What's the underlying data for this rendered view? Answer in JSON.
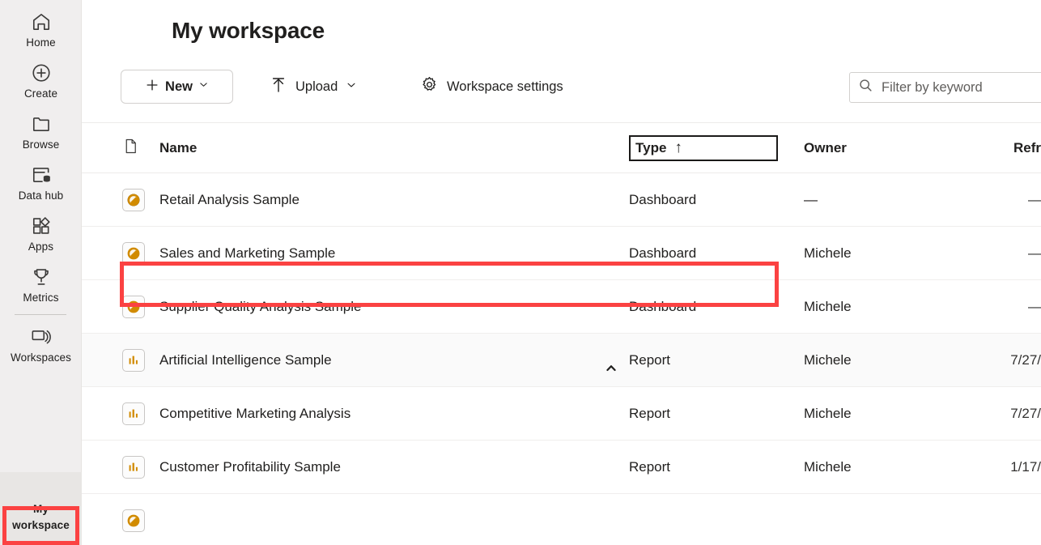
{
  "sidebar": {
    "items": [
      {
        "label": "Home",
        "icon": "home-icon"
      },
      {
        "label": "Create",
        "icon": "plus-circle-icon"
      },
      {
        "label": "Browse",
        "icon": "folder-icon"
      },
      {
        "label": "Data hub",
        "icon": "data-hub-icon"
      },
      {
        "label": "Apps",
        "icon": "apps-icon"
      },
      {
        "label": "Metrics",
        "icon": "trophy-icon"
      },
      {
        "label": "Workspaces",
        "icon": "workspaces-icon"
      }
    ],
    "selected": {
      "label_line1": "My",
      "label_line2": "workspace"
    },
    "accent_color": "#0f6e64"
  },
  "header": {
    "title": "My workspace"
  },
  "toolbar": {
    "new_label": "New",
    "upload_label": "Upload",
    "settings_label": "Workspace settings"
  },
  "search": {
    "placeholder": "Filter by keyword",
    "value": ""
  },
  "table": {
    "columns": {
      "icon": "",
      "name": "Name",
      "type": "Type",
      "owner": "Owner",
      "refresh": "Refr"
    },
    "sort": {
      "column": "Type",
      "direction": "ascending",
      "glyph": "↑"
    },
    "empty_value": "—",
    "rows": [
      {
        "icon": "dashboard-icon",
        "name": "Retail Analysis Sample",
        "type": "Dashboard",
        "owner": "—",
        "refresh": "—"
      },
      {
        "icon": "dashboard-icon",
        "name": "Sales and Marketing Sample",
        "type": "Dashboard",
        "owner": "Michele",
        "refresh": "—"
      },
      {
        "icon": "dashboard-icon",
        "name": "Supplier Quality Analysis Sample",
        "type": "Dashboard",
        "owner": "Michele",
        "refresh": "—"
      },
      {
        "icon": "report-icon",
        "name": "Artificial Intelligence Sample",
        "type": "Report",
        "owner": "Michele",
        "refresh": "7/27/"
      },
      {
        "icon": "report-icon",
        "name": "Competitive Marketing Analysis",
        "type": "Report",
        "owner": "Michele",
        "refresh": "7/27/"
      },
      {
        "icon": "report-icon",
        "name": "Customer Profitability Sample",
        "type": "Report",
        "owner": "Michele",
        "refresh": "1/17/"
      }
    ]
  },
  "annotations": {
    "color": "#fb4242",
    "highlighted_row": "Sales and Marketing Sample",
    "highlighted_nav": "My workspace"
  }
}
